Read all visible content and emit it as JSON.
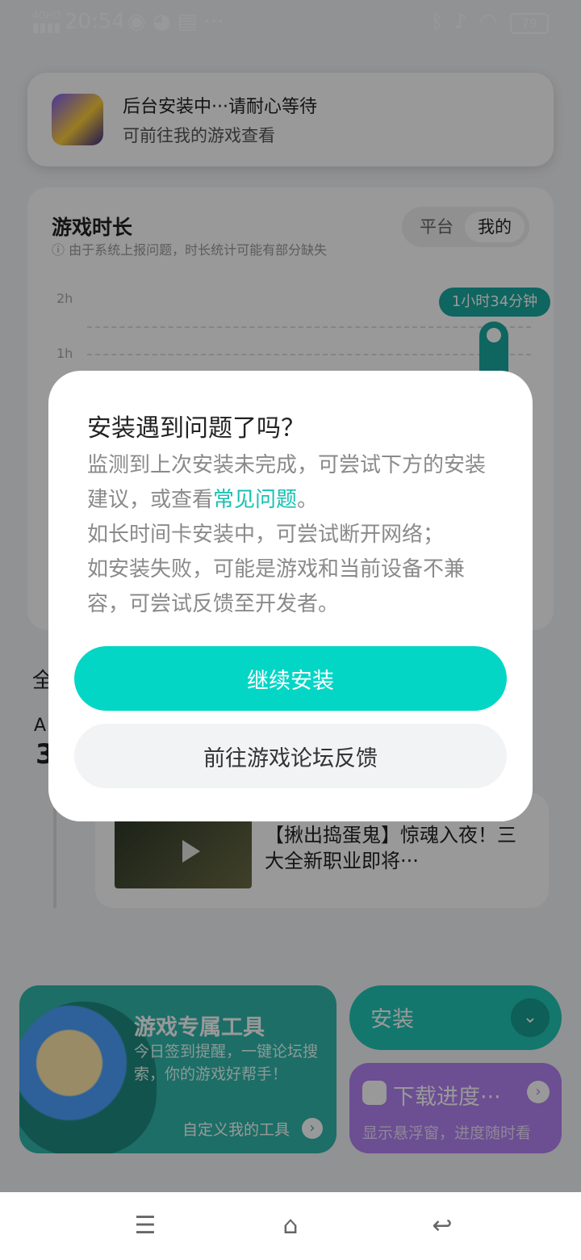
{
  "status_bar": {
    "network": "4GHD",
    "time": "20:54",
    "battery": "79"
  },
  "notification": {
    "title": "后台安装中···请耐心等待",
    "subtitle": "可前往我的游戏查看"
  },
  "game_time": {
    "title": "游戏时长",
    "note": "由于系统上报问题，时长统计可能有部分缺失",
    "toggle": [
      "平台",
      "我的"
    ],
    "y_labels": [
      "2h",
      "1h"
    ],
    "tooltip": "1小时34分钟"
  },
  "news": {
    "title": "【揪出捣蛋鬼】惊魂入夜！三大全新职业即将···"
  },
  "tools_card": {
    "title": "游戏专属工具",
    "desc": "今日签到提醒，一键论坛搜索，你的游戏好帮手！",
    "link": "自定义我的工具"
  },
  "install_button": {
    "label": "安装"
  },
  "download_card": {
    "title": "下载进度···",
    "desc": "显示悬浮窗，进度随时看"
  },
  "dialog": {
    "title": "安装遇到问题了吗？",
    "body_part1": "监测到上次安装未完成，可尝试下方的安装建议，或查看",
    "body_link": "常见问题",
    "body_part2": "。",
    "body_line2": "如长时间卡安装中，可尝试断开网络；",
    "body_line3": "如安装失败，可能是游戏和当前设备不兼容，可尝试反馈至开发者。",
    "primary_button": "继续安装",
    "secondary_button": "前往游戏论坛反馈"
  },
  "colors": {
    "accent": "#04d6c6",
    "link": "#16c1b2",
    "tools_bg": "#2fb7ac",
    "download_bg": "#b583f5"
  }
}
